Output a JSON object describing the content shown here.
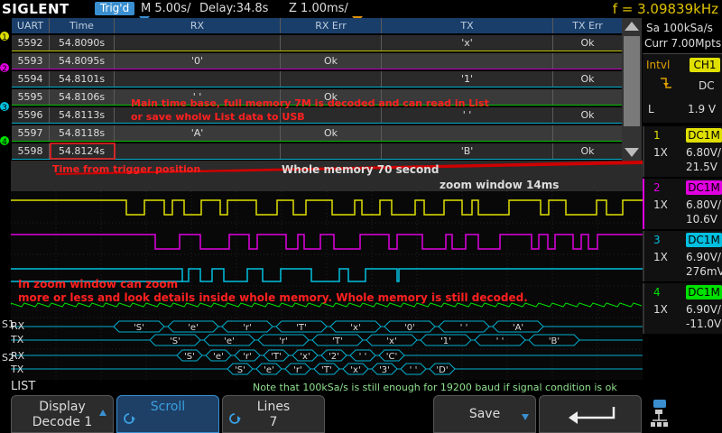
{
  "topbar": {
    "brand": "SIGLENT",
    "trig_status": "Trig'd",
    "timebase": "M 5.00s/",
    "delay": "Delay:34.8s",
    "zoom": "Z 1.00ms/",
    "frequency": "f = 3.09839kHz"
  },
  "list": {
    "headers": [
      "UART",
      "Time",
      "RX",
      "RX Err",
      "TX",
      "TX Err"
    ],
    "rows": [
      {
        "id": "5592",
        "time": "54.8090s",
        "rx": "",
        "rx_err": "",
        "tx": "'x'",
        "tx_err": "Ok",
        "color": "#c0c000"
      },
      {
        "id": "5593",
        "time": "54.8095s",
        "rx": "'0'",
        "rx_err": "Ok",
        "tx": "",
        "tx_err": "",
        "color": "#c000c0"
      },
      {
        "id": "5594",
        "time": "54.8101s",
        "rx": "",
        "rx_err": "",
        "tx": "'1'",
        "tx_err": "Ok",
        "color": "#00b0d0"
      },
      {
        "id": "5595",
        "time": "54.8106s",
        "rx": "' '",
        "rx_err": "Ok",
        "tx": "",
        "tx_err": "",
        "color": "#00c000"
      },
      {
        "id": "5596",
        "time": "54.8113s",
        "rx": "",
        "rx_err": "",
        "tx": "' '",
        "tx_err": "Ok",
        "color": "#00b0d0"
      },
      {
        "id": "5597",
        "time": "54.8118s",
        "rx": "'A'",
        "rx_err": "Ok",
        "tx": "",
        "tx_err": "",
        "color": "#00c000"
      },
      {
        "id": "5598",
        "time": "54.8124s",
        "rx": "",
        "rx_err": "",
        "tx": "'B'",
        "tx_err": "Ok",
        "color": "#00b0d0"
      }
    ]
  },
  "annotations": {
    "main_note_1": "Main time base, full memory 7M is decoded and can read in List",
    "main_note_2": "or save wholw List data to USB",
    "trigger_note": "Time from trigger position",
    "memory_note": "Whole memory 70 second",
    "zoom_window_note": "zoom window 14ms",
    "zoom_note_1": "In zoom window can zoom",
    "zoom_note_2": "more or less and look details inside whole memory. Whole memory is still decoded."
  },
  "right_panel": {
    "sample_rate": "Sa 100kSa/s",
    "memory": "Curr 7.00Mpts",
    "trigger_type": "Intvl",
    "trigger_source": "CH1",
    "coupling": "DC",
    "level_label": "L",
    "level": "1.9 V",
    "channels": [
      {
        "num": "1",
        "coupling": "DC1M",
        "probe": "1X",
        "scale": "6.80V/",
        "offset": "21.5V",
        "color": "#e0e000"
      },
      {
        "num": "2",
        "coupling": "DC1M",
        "probe": "1X",
        "scale": "6.80V/",
        "offset": "10.6V",
        "color": "#e000e0"
      },
      {
        "num": "3",
        "coupling": "DC1M",
        "probe": "1X",
        "scale": "6.90V/",
        "offset": "276mV",
        "color": "#00c0e0"
      },
      {
        "num": "4",
        "coupling": "DC1M",
        "probe": "1X",
        "scale": "6.90V/",
        "offset": "-11.0V",
        "color": "#00e000"
      }
    ]
  },
  "decode": {
    "bus1_rx": [
      "'S'",
      "'e'",
      "'r'",
      "'T'",
      "'x'",
      "'0'",
      "' '",
      "'A'"
    ],
    "bus1_tx": [
      "'S'",
      "'e'",
      "'r'",
      "'T'",
      "'x'",
      "'1'",
      "' '",
      "'B'"
    ],
    "bus2_rx": [
      "'S'",
      "'e'",
      "'r'",
      "'T'",
      "'x'",
      "'2'",
      "' '",
      "'C'"
    ],
    "bus2_tx": [
      "'S'",
      "'e'",
      "'r'",
      "'T'",
      "'x'",
      "'3'",
      "' '",
      "'D'"
    ],
    "rx_label": "RX",
    "tx_label": "TX",
    "s1": "S1",
    "s2": "S2"
  },
  "bottom": {
    "list_label": "LIST",
    "note": "Note that 100kSa/s is still enough for 19200 baud if signal condition is ok",
    "display_line1": "Display",
    "display_line2": "Decode 1",
    "scroll": "Scroll",
    "lines_label": "Lines",
    "lines_value": "7",
    "save": "Save"
  },
  "colors": {
    "ch1": "#e0e000",
    "ch2": "#e000e0",
    "ch3": "#00c0e0",
    "ch4": "#00e000",
    "annotation": "#ff2020"
  }
}
